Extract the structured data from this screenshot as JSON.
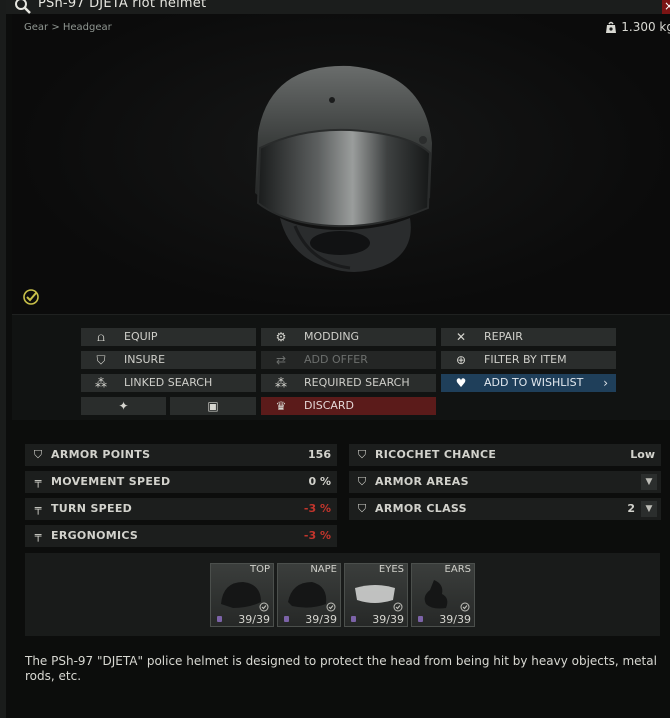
{
  "window": {
    "title": "PSh-97 DJETA riot helmet",
    "close_label": "×",
    "breadcrumb": "Gear > Headgear",
    "weight": "1.300 kg"
  },
  "actions": {
    "equip": "EQUIP",
    "modding": "MODDING",
    "repair": "REPAIR",
    "insure": "INSURE",
    "add_offer": "ADD OFFER",
    "filter_by_item": "FILTER BY ITEM",
    "linked_search": "LINKED SEARCH",
    "required_search": "REQUIRED SEARCH",
    "add_to_wishlist": "ADD TO WISHLIST",
    "discard": "DISCARD",
    "wishlist_chevron": "›"
  },
  "stats_left": [
    {
      "name": "ARMOR POINTS",
      "value": "156"
    },
    {
      "name": "MOVEMENT SPEED",
      "value": "0 %"
    },
    {
      "name": "TURN SPEED",
      "value": "-3 %"
    },
    {
      "name": "ERGONOMICS",
      "value": "-3 %"
    }
  ],
  "stats_right": [
    {
      "name": "RICOCHET CHANCE",
      "value": "Low"
    },
    {
      "name": "ARMOR AREAS",
      "value": ""
    },
    {
      "name": "ARMOR CLASS",
      "value": "2"
    }
  ],
  "armor_slots": [
    {
      "name": "TOP",
      "durability": "39/39"
    },
    {
      "name": "NAPE",
      "durability": "39/39"
    },
    {
      "name": "EYES",
      "durability": "39/39"
    },
    {
      "name": "EARS",
      "durability": "39/39"
    }
  ],
  "description": "The PSh-97 \"DJETA\" police helmet is designed to protect the head from being hit by heavy objects, metal rods, etc.",
  "colors": {
    "wishlist_bg": "#1f3f5a",
    "discard_bg": "#5b1b1a",
    "negative_stat": "#c2352c",
    "close_bg": "#7a1414"
  }
}
